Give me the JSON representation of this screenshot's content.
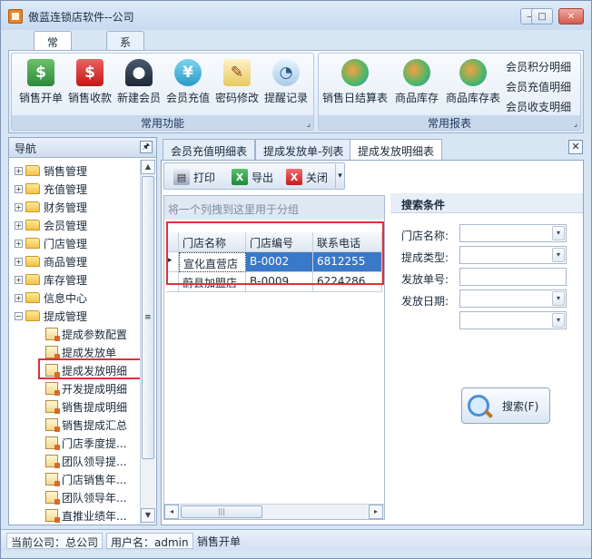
{
  "window": {
    "title": "傲蓝连锁店软件--公司",
    "min_glyph": "—",
    "max_glyph": "□",
    "close_glyph": "✕"
  },
  "ribbon": {
    "tabs": [
      "常用功能",
      "系统工具"
    ],
    "group_common": {
      "label": "常用功能",
      "buttons": [
        {
          "label": "销售开单",
          "icon": "cash-register-icon"
        },
        {
          "label": "销售收款",
          "icon": "dollar-icon"
        },
        {
          "label": "新建会员",
          "icon": "person-icon"
        },
        {
          "label": "会员充值",
          "icon": "yen-coin-icon"
        },
        {
          "label": "密码修改",
          "icon": "pencil-icon"
        },
        {
          "label": "提醒记录",
          "icon": "clock-calendar-icon"
        }
      ]
    },
    "group_reports": {
      "label": "常用报表",
      "buttons": [
        {
          "label": "销售日结算表",
          "icon": "chart-magnifier-icon"
        },
        {
          "label": "商品库存",
          "icon": "chart-magnifier-icon"
        },
        {
          "label": "商品库存表",
          "icon": "chart-magnifier-icon"
        }
      ],
      "links": [
        "会员积分明细",
        "会员充值明细",
        "会员收支明细"
      ]
    },
    "group_expander_glyph": "⌟"
  },
  "nav": {
    "title": "导航",
    "pin_glyph": "🖈",
    "expand_glyph": "+",
    "collapse_glyph": "−",
    "scroll_up_glyph": "▲",
    "scroll_down_glyph": "▼",
    "scroll_grip_glyph": "≡",
    "top_items": [
      "销售管理",
      "充值管理",
      "财务管理",
      "会员管理",
      "门店管理",
      "商品管理",
      "库存管理",
      "信息中心"
    ],
    "expanded_item": "提成管理",
    "sub_items": [
      "提成参数配置",
      "提成发放单",
      "提成发放明细",
      "开发提成明细",
      "销售提成明细",
      "销售提成汇总",
      "门店季度提...",
      "团队领导提...",
      "门店销售年...",
      "团队领导年...",
      "直推业绩年..."
    ],
    "selected_sub": "提成发放明细"
  },
  "doc_tabs": [
    "会员充值明细表",
    "提成发放单-列表",
    "提成发放明细表"
  ],
  "doc_close_glyph": "✕",
  "toolbar": {
    "print": "打印",
    "export": "导出",
    "close": "关闭",
    "export_glyph": "X",
    "close_glyph": "X",
    "dropdown_glyph": "▾"
  },
  "grid": {
    "group_hint": "将一个列拽到这里用于分组",
    "row_indicator": "▸",
    "columns": [
      "门店名称",
      "门店编号",
      "联系电话"
    ],
    "rows": [
      [
        "宣化直营店",
        "B-0002",
        "6812255"
      ],
      [
        "蔚县加盟店",
        "B-0009",
        "6224286"
      ]
    ],
    "scroll_left": "◂",
    "scroll_right": "▸",
    "scroll_grip": "|||"
  },
  "search": {
    "title": "搜索条件",
    "store_name_label": "门店名称:",
    "commission_type_label": "提成类型:",
    "issue_no_label": "发放单号:",
    "issue_date_label": "发放日期:",
    "dropdown_glyph": "▾",
    "button": "搜索(F)"
  },
  "status": {
    "company": "当前公司：总公司",
    "user": "用户名：admin",
    "action": "销售开单"
  },
  "colors": {
    "accent_selection": "#3a78c8",
    "annotation_red": "#e0303a"
  }
}
